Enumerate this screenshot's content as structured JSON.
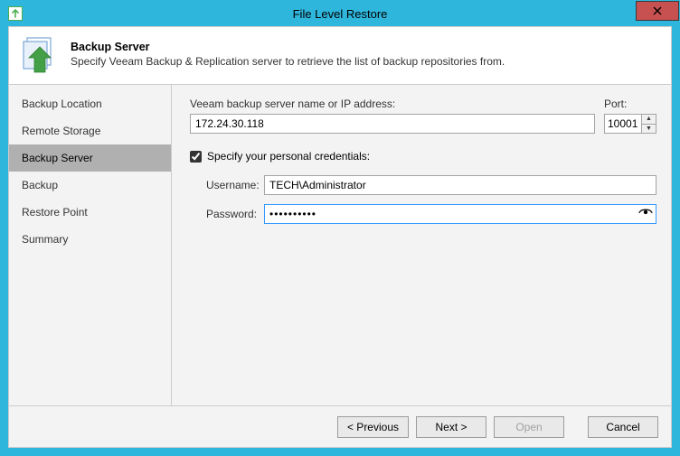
{
  "window": {
    "title": "File Level Restore"
  },
  "header": {
    "title": "Backup Server",
    "description": "Specify Veeam Backup & Replication server to retrieve the list of backup repositories from."
  },
  "sidebar": {
    "items": [
      {
        "label": "Backup Location",
        "selected": false
      },
      {
        "label": "Remote Storage",
        "selected": false
      },
      {
        "label": "Backup Server",
        "selected": true
      },
      {
        "label": "Backup",
        "selected": false
      },
      {
        "label": "Restore Point",
        "selected": false
      },
      {
        "label": "Summary",
        "selected": false
      }
    ]
  },
  "form": {
    "server_label": "Veeam backup server name or IP address:",
    "server_value": "172.24.30.118",
    "port_label": "Port:",
    "port_value": "10001",
    "specify_credentials_label": "Specify your personal credentials:",
    "specify_credentials_checked": true,
    "username_label": "Username:",
    "username_value": "TECH\\Administrator",
    "password_label": "Password:",
    "password_value": "••••••••••"
  },
  "footer": {
    "previous": "< Previous",
    "next": "Next >",
    "open": "Open",
    "cancel": "Cancel"
  }
}
